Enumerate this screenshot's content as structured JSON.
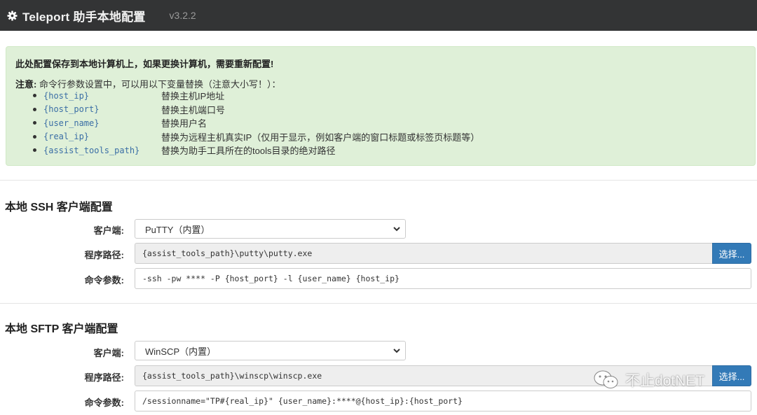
{
  "header": {
    "title": "Teleport 助手本地配置",
    "version": "v3.2.2",
    "icon": "gear-icon"
  },
  "notice": {
    "headline": "此处配置保存到本地计算机上，如果更换计算机，需要重新配置!",
    "note_label": "注意:",
    "note_text": "命令行参数设置中，可以用以下变量替换（注意大小写！）：",
    "variables": [
      {
        "name": "{host_ip}",
        "desc": "替换主机IP地址"
      },
      {
        "name": "{host_port}",
        "desc": "替换主机端口号"
      },
      {
        "name": "{user_name}",
        "desc": "替换用户名"
      },
      {
        "name": "{real_ip}",
        "desc": "替换为远程主机真实IP（仅用于显示，例如客户端的窗口标题或标签页标题等）"
      },
      {
        "name": "{assist_tools_path}",
        "desc": "替换为助手工具所在的tools目录的绝对路径"
      }
    ]
  },
  "ssh": {
    "title": "本地 SSH 客户端配置",
    "client_label": "客户端:",
    "client_value": "PuTTY（内置）",
    "path_label": "程序路径:",
    "path_value": "{assist_tools_path}\\putty\\putty.exe",
    "browse_label": "选择...",
    "args_label": "命令参数:",
    "args_value": "-ssh -pw **** -P {host_port} -l {user_name} {host_ip}"
  },
  "sftp": {
    "title": "本地 SFTP 客户端配置",
    "client_label": "客户端:",
    "client_value": "WinSCP（内置）",
    "path_label": "程序路径:",
    "path_value": "{assist_tools_path}\\winscp\\winscp.exe",
    "browse_label": "选择...",
    "args_label": "命令参数:",
    "args_value": "/sessionname=\"TP#{real_ip}\" {user_name}:****@{host_ip}:{host_port}"
  },
  "watermark": {
    "text": "不止dotNET",
    "icon": "wechat-icon"
  }
}
